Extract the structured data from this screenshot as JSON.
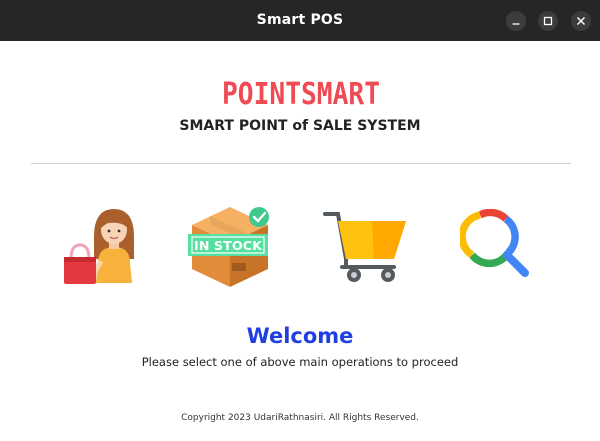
{
  "window": {
    "title": "Smart POS"
  },
  "brand": {
    "logo_text": "POINTSMART",
    "logo_color": "#ef4b55",
    "subtitle": "SMART POINT of SALE SYSTEM"
  },
  "operations": [
    {
      "icon": "shopping-customer-icon"
    },
    {
      "icon": "in-stock-box-icon",
      "badge_text": "IN STOCK"
    },
    {
      "icon": "shopping-cart-icon"
    },
    {
      "icon": "search-icon"
    }
  ],
  "main": {
    "welcome": "Welcome",
    "instructions": "Please select one of above main operations to proceed",
    "welcome_color": "#1f3fe0"
  },
  "footer": {
    "copyright": "Copyright 2023 UdariRathnasiri. All Rights Reserved."
  }
}
